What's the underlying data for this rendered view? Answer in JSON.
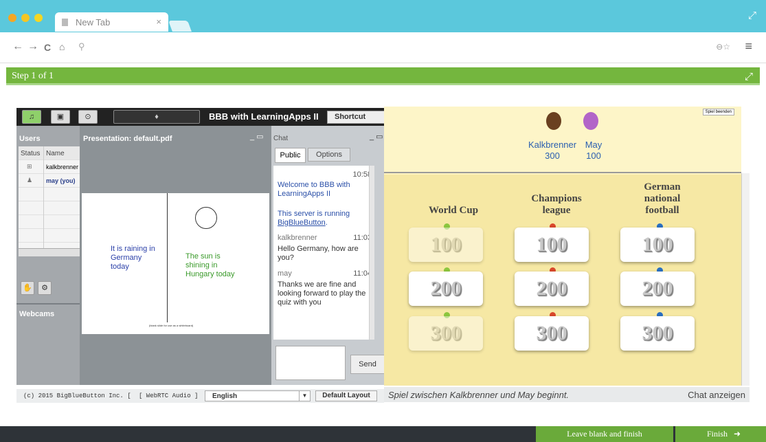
{
  "browser": {
    "tab_title": "New Tab",
    "tab_close": "×"
  },
  "step": {
    "label": "Step 1 of 1"
  },
  "bbb": {
    "title": "BBB with LearningApps II",
    "shortcut_keys": "Shortcut Keys",
    "users_title": "Users",
    "col_status": "Status",
    "col_name": "Name",
    "users": [
      {
        "name": "kalkbrenner",
        "bold": false
      },
      {
        "name": "may (you)",
        "bold": true
      }
    ],
    "webcams_title": "Webcams",
    "presentation_title": "Presentation: default.pdf",
    "slide": {
      "text_left": "It is raining in Germany today",
      "text_right": "The sun is shining in Hungary today",
      "footer_note": "(blank slide for use as a whiteboard)"
    },
    "chat_title": "Chat",
    "chat_tabs": [
      "Public",
      "Options"
    ],
    "messages": [
      {
        "sender": "",
        "time": "10:58",
        "lines": [
          "Welcome to BBB with LearningApps II"
        ],
        "color": "#2a4fa8"
      },
      {
        "sender": "",
        "time": "",
        "lines": [
          "This server is running"
        ],
        "link": "BigBlueButton",
        "color": "#2a4fa8"
      },
      {
        "sender": "kalkbrenner",
        "time": "11:03",
        "lines": [
          "Hello Germany, how are you?"
        ],
        "color": "#333"
      },
      {
        "sender": "may",
        "time": "11:04",
        "lines": [
          "Thanks we are fine and looking forward to play the quiz with you"
        ],
        "color": "#333"
      }
    ],
    "send_label": "Send",
    "footer_copyright": "(c) 2015 BigBlueButton Inc. [",
    "footer_audio": "[ WebRTC Audio ]",
    "language": "English",
    "layout": "Default Layout"
  },
  "game": {
    "spiel_beenden": "Spiel beenden",
    "players": [
      {
        "name": "Kalkbrenner",
        "score": "300"
      },
      {
        "name": "May",
        "score": "100"
      }
    ],
    "categories": [
      {
        "title": "World Cup",
        "pin_color": "#8cc63e",
        "values": [
          "100",
          "200",
          "300"
        ],
        "used": [
          true,
          false,
          true
        ]
      },
      {
        "title": "Champions league",
        "pin_color": "#d9472b",
        "values": [
          "100",
          "200",
          "300"
        ],
        "used": [
          false,
          false,
          false
        ]
      },
      {
        "title": "German national football",
        "pin_color": "#2a6fc0",
        "values": [
          "100",
          "200",
          "300"
        ],
        "used": [
          false,
          false,
          false
        ]
      }
    ],
    "status_text": "Spiel zwischen Kalkbrenner und May beginnt.",
    "chat_toggle": "Chat anzeigen"
  },
  "footer": {
    "leave_blank": "Leave blank and finish",
    "finish": "Finish"
  }
}
